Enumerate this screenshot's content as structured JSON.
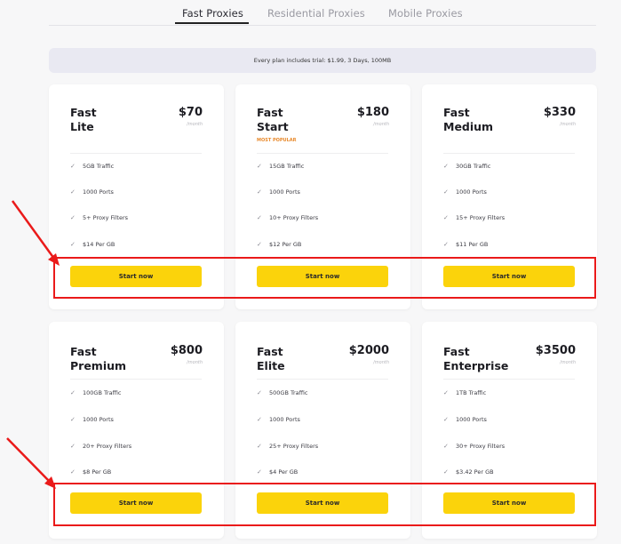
{
  "tabs": [
    "Fast Proxies",
    "Residential Proxies",
    "Mobile Proxies"
  ],
  "trial_text": "Every plan includes trial: $1.99, 3 Days, 100MB",
  "button_label": "Start now",
  "per_label": "/month",
  "accent_color": "#fbd30b",
  "highlight_color": "#ea1a1a",
  "plans": [
    {
      "line1": "Fast",
      "line2": "Lite",
      "price": "$70",
      "features": [
        "5GB Traffic",
        "1000 Ports",
        "5+ Proxy Filters",
        "$14 Per GB"
      ]
    },
    {
      "line1": "Fast",
      "line2": "Start",
      "price": "$180",
      "badge": "MOST POPULAR",
      "features": [
        "15GB Traffic",
        "1000 Ports",
        "10+ Proxy Filters",
        "$12 Per GB"
      ]
    },
    {
      "line1": "Fast",
      "line2": "Medium",
      "price": "$330",
      "features": [
        "30GB Traffic",
        "1000 Ports",
        "15+ Proxy Filters",
        "$11 Per GB"
      ]
    },
    {
      "line1": "Fast",
      "line2": "Premium",
      "price": "$800",
      "features": [
        "100GB Traffic",
        "1000 Ports",
        "20+ Proxy Filters",
        "$8 Per GB"
      ]
    },
    {
      "line1": "Fast",
      "line2": "Elite",
      "price": "$2000",
      "features": [
        "500GB Traffic",
        "1000 Ports",
        "25+ Proxy Filters",
        "$4 Per GB"
      ]
    },
    {
      "line1": "Fast",
      "line2": "Enterprise",
      "price": "$3500",
      "features": [
        "1TB Traffic",
        "1000 Ports",
        "30+ Proxy Filters",
        "$3.42 Per GB"
      ]
    }
  ]
}
